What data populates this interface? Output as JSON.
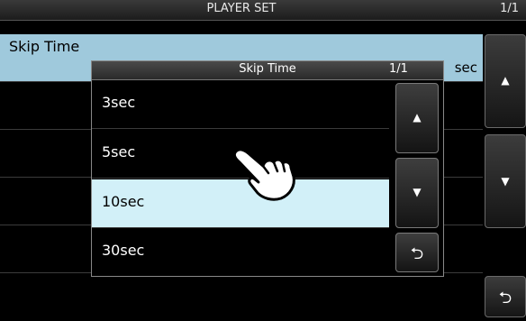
{
  "header": {
    "title": "PLAYER SET",
    "page": "1/1"
  },
  "background_list": {
    "items": [
      {
        "label": "Skip Time",
        "value": "10sec",
        "visible_value_fragment": "sec"
      }
    ]
  },
  "side_buttons": {
    "up_icon": "▲",
    "down_icon": "▼",
    "back_icon": "⮌"
  },
  "popup": {
    "title": "Skip Time",
    "page": "1/1",
    "options": [
      "3sec",
      "5sec",
      "10sec",
      "30sec"
    ],
    "selected": "10sec",
    "buttons": {
      "up_icon": "▲",
      "down_icon": "▼",
      "back_icon": "⮌"
    }
  },
  "colors": {
    "selected_row_bg": "#9fc9dc",
    "selected_option_bg": "#d2f0f8",
    "screen_bg": "#000000"
  },
  "icons": {
    "touch_pointer": "pointing-hand-icon"
  }
}
